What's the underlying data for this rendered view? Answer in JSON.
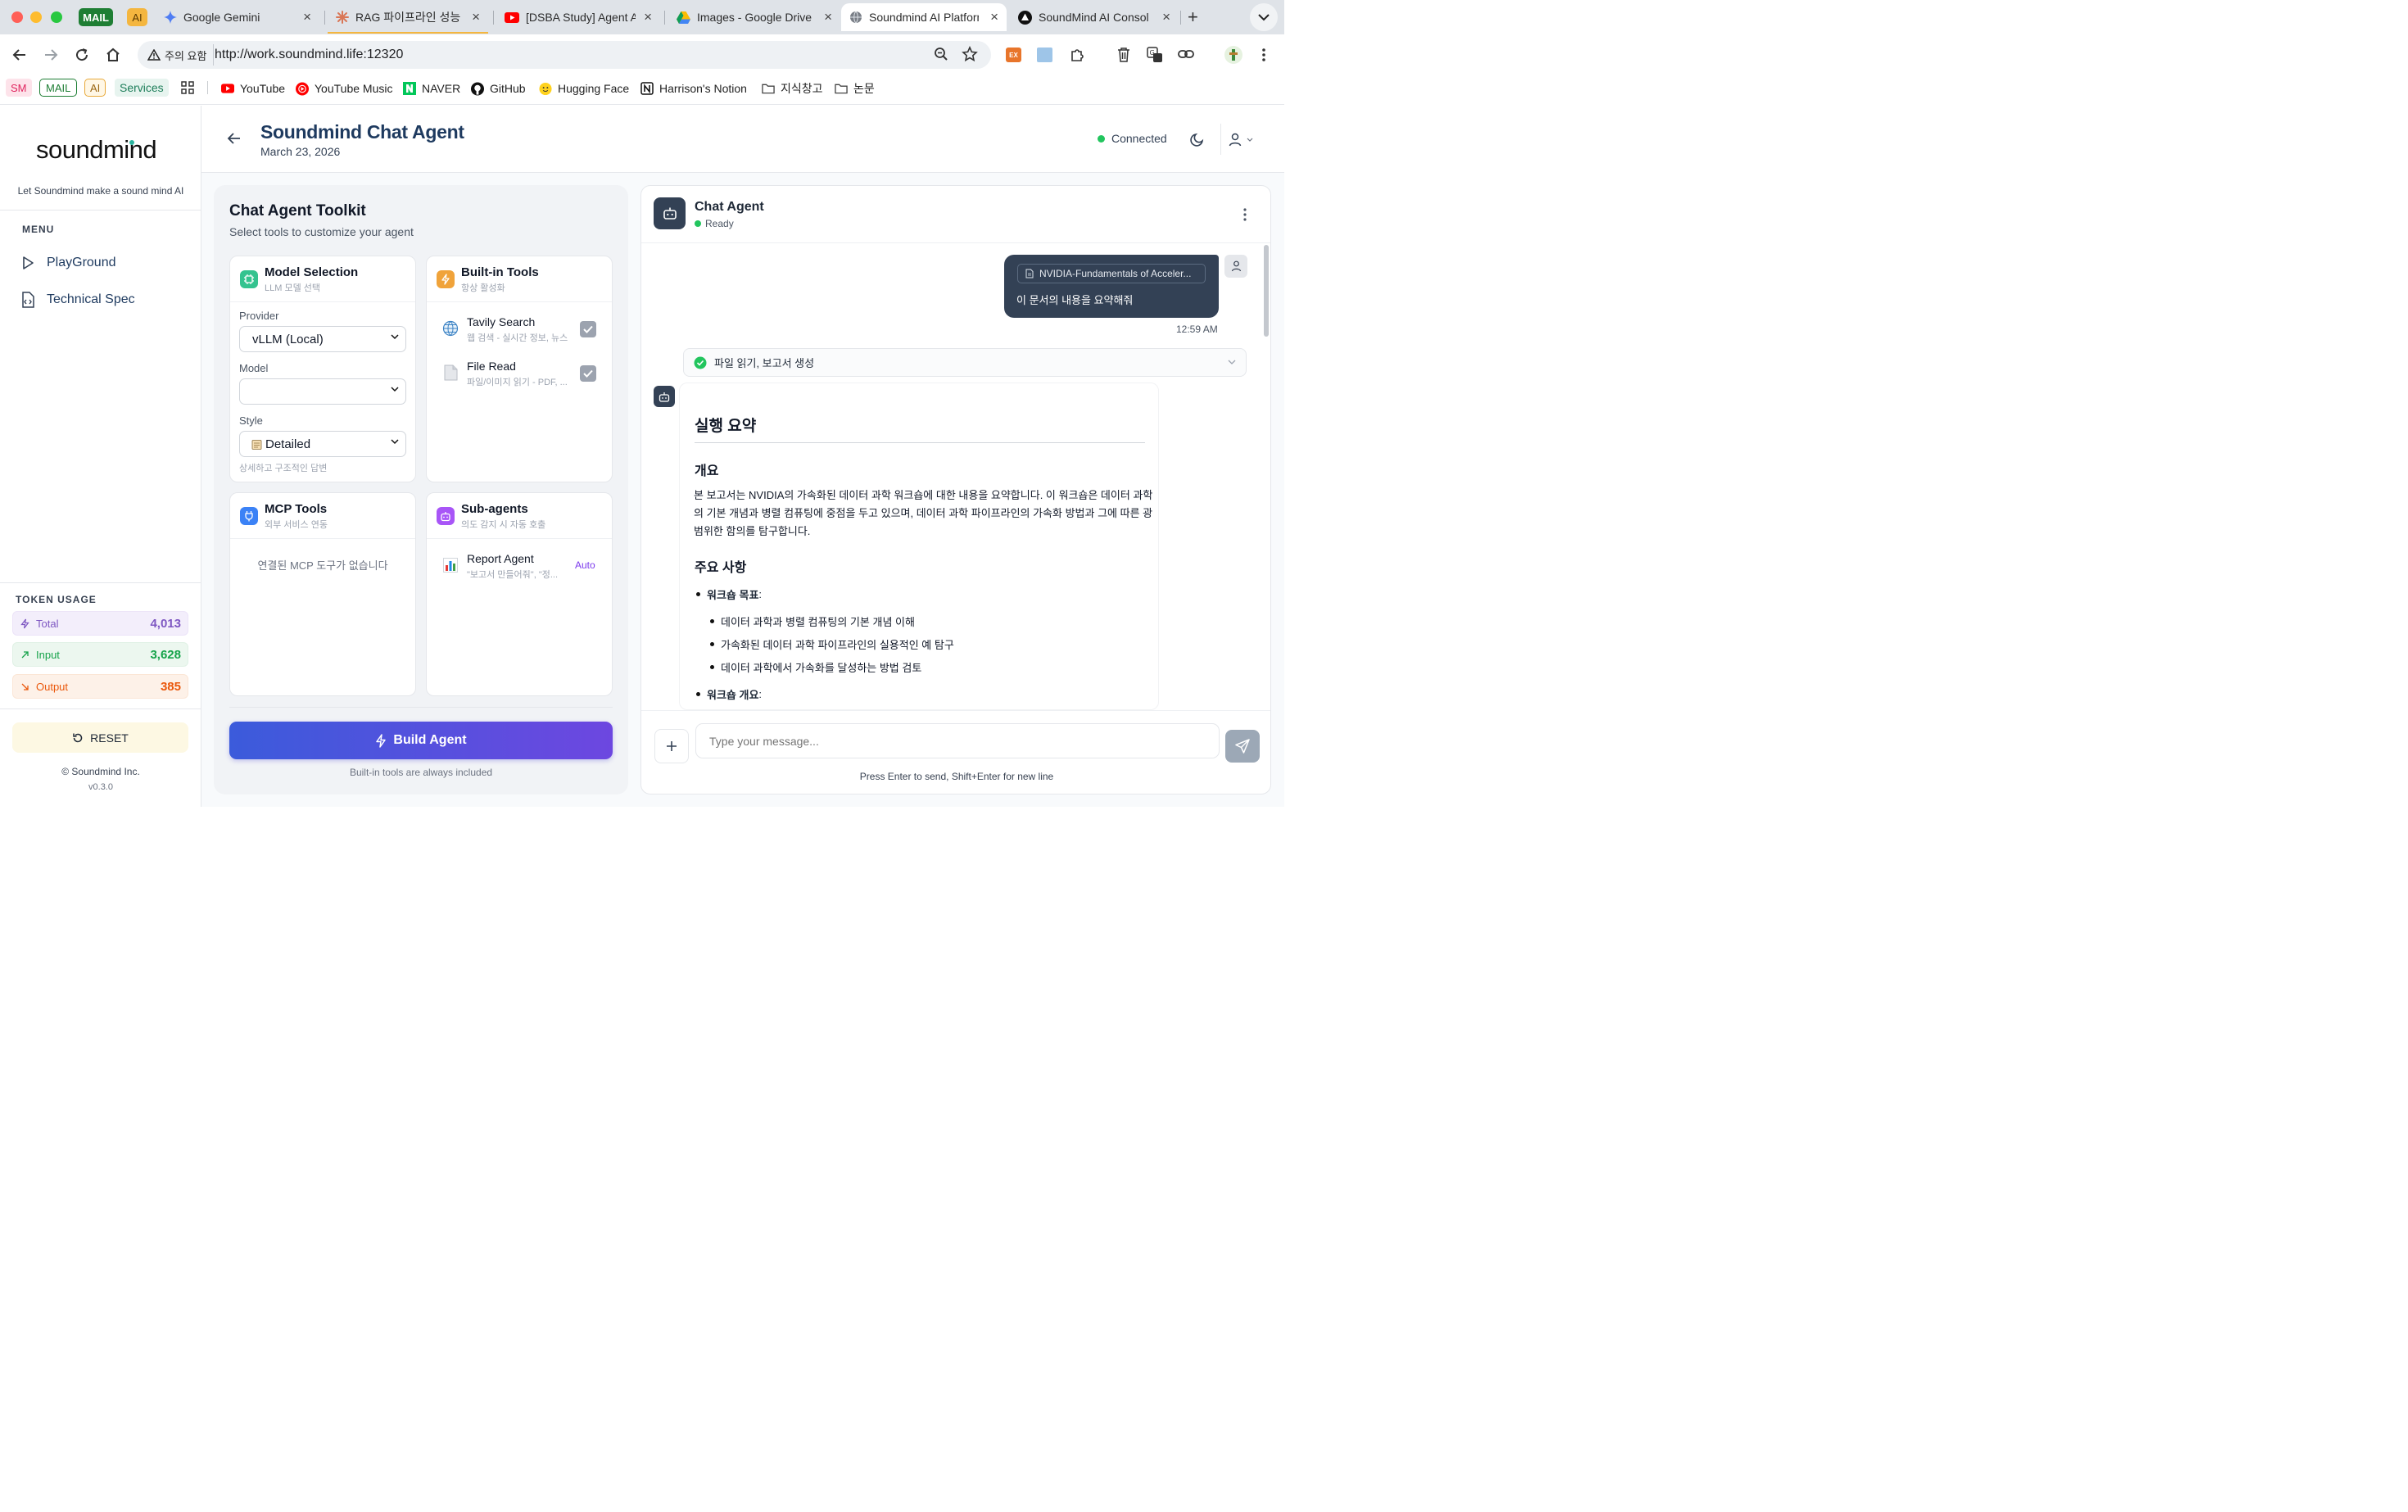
{
  "browser": {
    "tabs": [
      {
        "label": "Google Gemini"
      },
      {
        "label": "RAG 파이프라인 성능 평가"
      },
      {
        "label": "[DSBA Study] Agent A"
      },
      {
        "label": "Images - Google Drive"
      },
      {
        "label": "Soundmind AI Platform"
      },
      {
        "label": "SoundMind AI Console"
      }
    ],
    "pinned": {
      "mail": "MAIL",
      "ai": "AI"
    },
    "security_label": "주의 요함",
    "url": "http://work.soundmind.life:12320",
    "bookmarks": {
      "sm": "SM",
      "mail": "MAIL",
      "ai": "AI",
      "services": "Services",
      "youtube": "YouTube",
      "youtube_music": "YouTube Music",
      "naver": "NAVER",
      "github": "GitHub",
      "hugging_face": "Hugging Face",
      "notion": "Harrison's Notion",
      "folder1": "지식창고",
      "folder2": "논문"
    },
    "ext_ex": "EX"
  },
  "sidebar": {
    "logo": "soundmind",
    "tagline": "Let Soundmind make a sound mind AI",
    "menu_title": "MENU",
    "items": [
      {
        "label": "PlayGround"
      },
      {
        "label": "Technical Spec"
      }
    ],
    "token_usage": {
      "title": "TOKEN USAGE",
      "total_label": "Total",
      "total_value": "4,013",
      "input_label": "Input",
      "input_value": "3,628",
      "output_label": "Output",
      "output_value": "385"
    },
    "reset_label": "RESET",
    "copyright": "© Soundmind Inc.",
    "version": "v0.3.0"
  },
  "header": {
    "title": "Soundmind Chat Agent",
    "date": "March 23, 2026",
    "status": "Connected"
  },
  "toolkit": {
    "title": "Chat Agent Toolkit",
    "subtitle": "Select tools to customize your agent",
    "model_selection": {
      "title": "Model Selection",
      "subtitle": "LLM 모델 선택",
      "provider_label": "Provider",
      "provider_value": "vLLM (Local)",
      "model_label": "Model",
      "model_value": "",
      "style_label": "Style",
      "style_value": "Detailed",
      "style_hint": "상세하고 구조적인 답변"
    },
    "builtin": {
      "title": "Built-in Tools",
      "subtitle": "항상 활성화",
      "tools": [
        {
          "name": "Tavily Search",
          "desc": "웹 검색 - 실시간 정보, 뉴스"
        },
        {
          "name": "File Read",
          "desc": "파일/이미지 읽기 - PDF, ..."
        }
      ]
    },
    "mcp": {
      "title": "MCP Tools",
      "subtitle": "외부 서비스 연동",
      "empty": "연결된 MCP 도구가 없습니다"
    },
    "subagents": {
      "title": "Sub-agents",
      "subtitle": "의도 감지 시 자동 호출",
      "agents": [
        {
          "name": "Report Agent",
          "desc": "\"보고서 만들어줘\", \"정...",
          "badge": "Auto"
        }
      ]
    },
    "build_label": "Build Agent",
    "build_hint": "Built-in tools are always included"
  },
  "chat": {
    "agent_name": "Chat Agent",
    "agent_status": "Ready",
    "user_message": {
      "attachment": "NVIDIA-Fundamentals of Acceler...",
      "text": "이 문서의 내용을 요약해줘",
      "time": "12:59 AM"
    },
    "tool_step": "파일 읽기, 보고서 생성",
    "response": {
      "h1": "실행 요약",
      "h2_overview": "개요",
      "overview_line1": "본 보고서는 NVIDIA의 가속화된 데이터 과학 워크숍에 대한 내용을 요약합니다. 이 워크숍은 데이터 과학",
      "overview_line2": "의 기본 개념과 병렬 컴퓨팅에 중점을 두고 있으며, 데이터 과학 파이프라인의 가속화 방법과 그에 따른 광",
      "overview_line3": "범위한 함의를 탐구합니다.",
      "h2_main": "주요 사항",
      "bullet1_label": "워크숍 목표",
      "sub_bullets": [
        "데이터 과학과 병렬 컴퓨팅의 기본 개념 이해",
        "가속화된 데이터 과학 파이프라인의 실용적인 예 탐구",
        "데이터 과학에서 가속화를 달성하는 방법 검토"
      ],
      "bullet2_label": "워크숍 개요"
    },
    "input_placeholder": "Type your message...",
    "input_hint": "Press Enter to send, Shift+Enter for new line"
  },
  "colors": {
    "navy": "#334155",
    "accent_purple": "#7c3aed",
    "build_gradient_start": "#3b5bdb",
    "build_gradient_end": "#6d47e0",
    "status_green": "#22c55e",
    "total_color": "#7e57c2",
    "input_color": "#16a34a",
    "output_color": "#ea580c"
  },
  "icons": [
    "back-arrow-icon",
    "play-icon",
    "document-code-icon",
    "moon-icon",
    "user-icon",
    "robot-icon",
    "chip-icon",
    "lightning-icon",
    "plug-icon",
    "globe-icon",
    "file-icon",
    "bar-chart-icon",
    "checkmark-icon",
    "chevron-down-icon",
    "kebab-menu-icon",
    "plus-icon",
    "send-icon",
    "reset-icon",
    "check-circle-icon"
  ]
}
